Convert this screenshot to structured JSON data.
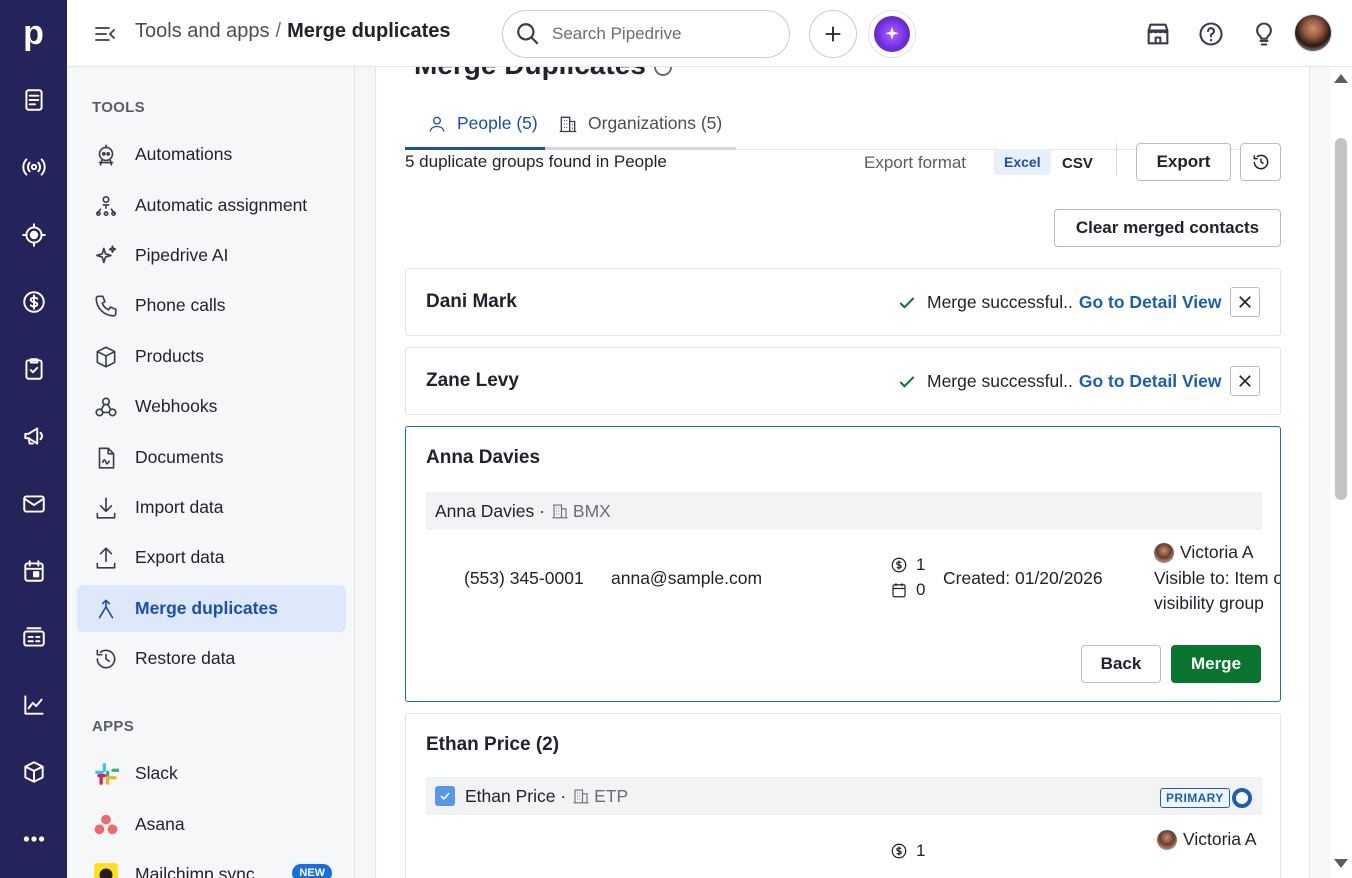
{
  "app": {
    "logo": "p"
  },
  "rail": {
    "icons": [
      "leads-icon",
      "signal-icon",
      "target-icon",
      "dollar-icon",
      "clipboard-check-icon",
      "megaphone-icon",
      "mail-icon",
      "calendar-icon",
      "contact-card-icon",
      "chart-icon",
      "box-icon",
      "more-icon"
    ]
  },
  "header": {
    "breadcrumb_parent": "Tools and apps",
    "breadcrumb_sep": "/",
    "breadcrumb_current": "Merge duplicates",
    "search_placeholder": "Search Pipedrive"
  },
  "sidebar": {
    "tools_title": "TOOLS",
    "tools": [
      {
        "label": "Automations",
        "icon": "robot-icon"
      },
      {
        "label": "Automatic assignment",
        "icon": "assignment-icon"
      },
      {
        "label": "Pipedrive AI",
        "icon": "sparkle-icon"
      },
      {
        "label": "Phone calls",
        "icon": "phone-icon"
      },
      {
        "label": "Products",
        "icon": "box-icon"
      },
      {
        "label": "Webhooks",
        "icon": "webhook-icon"
      },
      {
        "label": "Documents",
        "icon": "document-icon"
      },
      {
        "label": "Import data",
        "icon": "import-icon"
      },
      {
        "label": "Export data",
        "icon": "export-icon"
      },
      {
        "label": "Merge duplicates",
        "icon": "merge-icon",
        "active": true
      },
      {
        "label": "Restore data",
        "icon": "restore-icon"
      }
    ],
    "apps_title": "APPS",
    "apps": [
      {
        "label": "Slack",
        "icon": "slack-icon"
      },
      {
        "label": "Asana",
        "icon": "asana-icon"
      },
      {
        "label": "Mailchimp sync",
        "icon": "mailchimp-icon",
        "badge": "NEW"
      }
    ]
  },
  "main": {
    "title": "Merge Duplicates",
    "tabs": [
      {
        "label": "People (5)",
        "active": true
      },
      {
        "label": "Organizations (5)",
        "active": false
      }
    ],
    "found_text": "5 duplicate groups found in People",
    "export_format_label": "Export format",
    "format_excel": "Excel",
    "format_csv": "CSV",
    "export_button": "Export",
    "clear_button": "Clear merged contacts",
    "merged": [
      {
        "name": "Dani Mark",
        "status": "Merge successful..",
        "link": "Go to Detail View"
      },
      {
        "name": "Zane Levy",
        "status": "Merge successful..",
        "link": "Go to Detail View"
      }
    ],
    "selected_group": {
      "name": "Anna Davies",
      "row_name": "Anna Davies ·",
      "row_org": "BMX",
      "phone": "(553) 345-0001",
      "email": "anna@sample.com",
      "deals": "1",
      "activities": "0",
      "created": "Created: 01/20/2026",
      "owner": "Victoria A",
      "visible_line1": "Visible to: Item o",
      "visible_line2": "visibility group",
      "back_button": "Back",
      "merge_button": "Merge"
    },
    "next_group": {
      "name": "Ethan Price (2)",
      "row_name": "Ethan Price ·",
      "row_org": "ETP",
      "primary_badge": "PRIMARY",
      "deals": "1",
      "owner": "Victoria A"
    }
  }
}
